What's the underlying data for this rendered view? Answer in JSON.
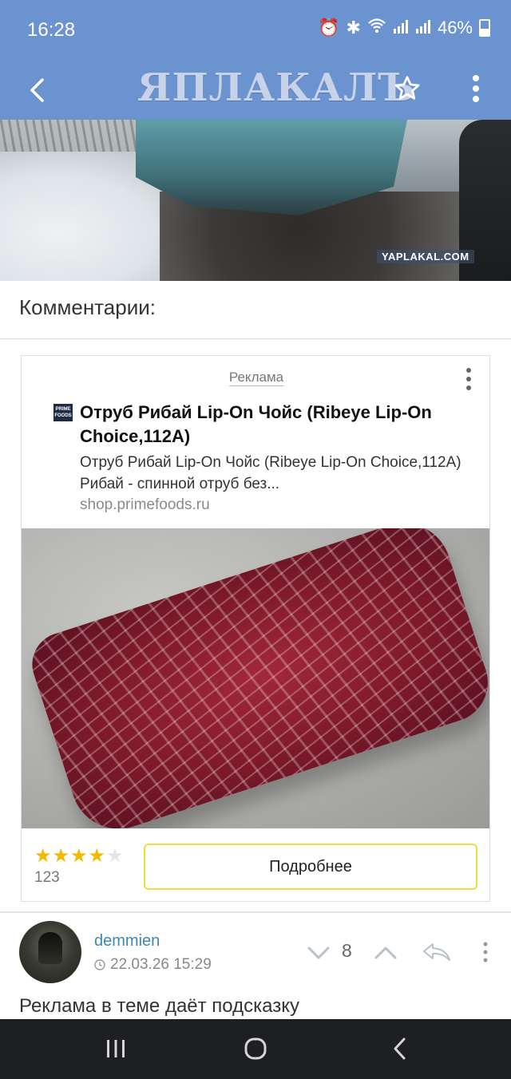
{
  "status_bar": {
    "time": "16:28",
    "battery": "46%"
  },
  "app_bar": {
    "logo_text": "ЯПЛАКАЛЪ"
  },
  "post": {
    "watermark": "YAPLAKAL.COM"
  },
  "comments_section": {
    "title": "Комментарии:"
  },
  "ad": {
    "label": "Реклама",
    "brand_logo_text": "PRIME FOODS",
    "title": "Отруб Рибай Lip-On Чойс (Ribeye Lip-On Choice,112A)",
    "description": "Отруб Рибай Lip-On Чойс (Ribeye Lip-On Choice,112A) Рибай - спинной отруб без...",
    "url": "shop.primefoods.ru",
    "rating": {
      "stars": 4,
      "max": 5,
      "count": "123"
    },
    "button_label": "Подробнее"
  },
  "comment": {
    "username": "demmien",
    "timestamp": "22.03.26 15:29",
    "score": "8",
    "text": "Реклама в теме даёт подсказку"
  },
  "colors": {
    "app_bar": "#6a93d0",
    "username": "#3d86b5",
    "star": "#f5b800",
    "button_border": "#f0dc3a",
    "nav_bar": "#1e1f22"
  }
}
